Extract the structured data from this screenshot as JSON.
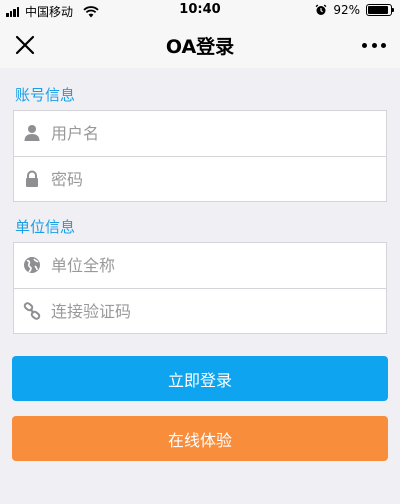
{
  "status_bar": {
    "carrier": "中国移动",
    "time": "10:40",
    "battery_percent": "92%",
    "battery_level": 0.92,
    "icons": [
      "signal-icon",
      "wifi-icon",
      "alarm-icon",
      "battery-icon"
    ]
  },
  "nav": {
    "title": "OA登录",
    "close_icon": "close-icon",
    "more_icon": "more-icon"
  },
  "account_section": {
    "label": "账号信息",
    "username_placeholder": "用户名",
    "password_placeholder": "密码"
  },
  "unit_section": {
    "label": "单位信息",
    "unit_name_placeholder": "单位全称",
    "connect_code_placeholder": "连接验证码"
  },
  "buttons": {
    "login_label": "立即登录",
    "trial_label": "在线体验"
  },
  "colors": {
    "accent_blue": "#1aa0e8",
    "login_button": "#0ea4ef",
    "trial_button": "#f88d3c",
    "background": "#efeff4"
  }
}
